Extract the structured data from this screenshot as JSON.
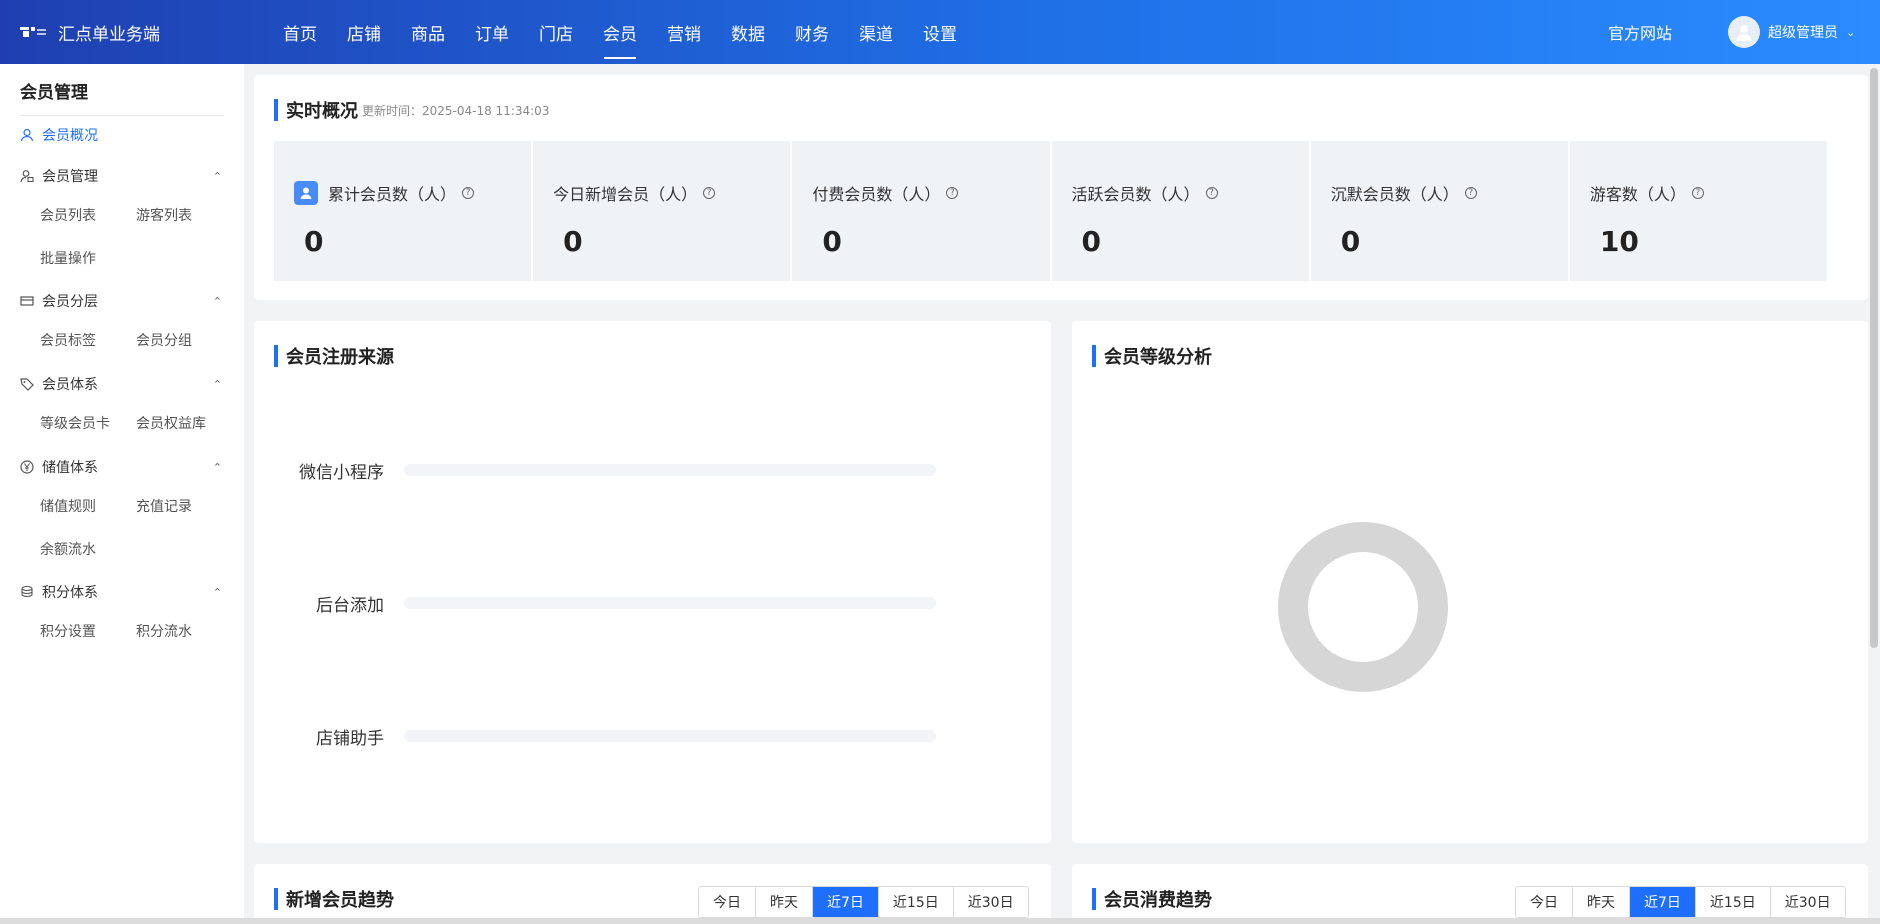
{
  "header": {
    "brand": "汇点单业务端",
    "nav": [
      "首页",
      "店铺",
      "商品",
      "订单",
      "门店",
      "会员",
      "营销",
      "数据",
      "财务",
      "渠道",
      "设置"
    ],
    "active_nav": "会员",
    "site_link": "官方网站",
    "user_name": "超级管理员"
  },
  "sidebar": {
    "title": "会员管理",
    "overview": "会员概况",
    "groups": [
      {
        "label": "会员管理",
        "icon": "user-group-icon",
        "items": [
          "会员列表",
          "游客列表",
          "批量操作"
        ]
      },
      {
        "label": "会员分层",
        "icon": "card-icon",
        "items": [
          "会员标签",
          "会员分组"
        ]
      },
      {
        "label": "会员体系",
        "icon": "tag-icon",
        "items": [
          "等级会员卡",
          "会员权益库"
        ]
      },
      {
        "label": "储值体系",
        "icon": "yen-icon",
        "items": [
          "储值规则",
          "充值记录",
          "余额流水"
        ]
      },
      {
        "label": "积分体系",
        "icon": "stack-icon",
        "items": [
          "积分设置",
          "积分流水"
        ]
      }
    ]
  },
  "realtime": {
    "title": "实时概况",
    "updated": "更新时间：2025-04-18 11:34:03",
    "stats": [
      {
        "label": "累计会员数（人）",
        "value": "0"
      },
      {
        "label": "今日新增会员（人）",
        "value": "0"
      },
      {
        "label": "付费会员数（人）",
        "value": "0"
      },
      {
        "label": "活跃会员数（人）",
        "value": "0"
      },
      {
        "label": "沉默会员数（人）",
        "value": "0"
      },
      {
        "label": "游客数（人）",
        "value": "10"
      }
    ]
  },
  "source": {
    "title": "会员注册来源",
    "rows": [
      "微信小程序",
      "后台添加",
      "店铺助手"
    ]
  },
  "level": {
    "title": "会员等级分析"
  },
  "trend_new": {
    "title": "新增会员趋势"
  },
  "trend_spend": {
    "title": "会员消费趋势"
  },
  "ranges": [
    "今日",
    "昨天",
    "近7日",
    "近15日",
    "近30日"
  ],
  "active_range": "近7日",
  "colors": {
    "primary": "#1e6fff",
    "donut": "#d6d6d6"
  }
}
